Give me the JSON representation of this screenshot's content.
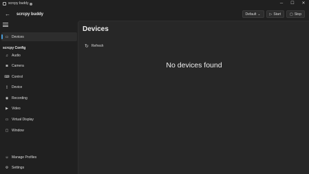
{
  "window": {
    "title": "scrcpy buddy",
    "controls": {
      "minimize": "─",
      "maximize": "☐",
      "close": "✕"
    }
  },
  "header": {
    "app_name": "scrcpy buddy",
    "back_icon": "←",
    "profile_label": "Default",
    "profile_icon": "⌄",
    "start_label": "Start",
    "start_icon": "▷",
    "stop_label": "Stop",
    "stop_icon": "▢"
  },
  "sidebar": {
    "items_top": [
      {
        "label": "Devices",
        "icon": "▭",
        "selected": true
      }
    ],
    "section_title": "scrcpy Config",
    "config_items": [
      {
        "label": "Audio",
        "icon": "♫"
      },
      {
        "label": "Camera",
        "icon": "◙"
      },
      {
        "label": "Control",
        "icon": "⌨"
      },
      {
        "label": "Device",
        "icon": "▯"
      },
      {
        "label": "Recording",
        "icon": "◉"
      },
      {
        "label": "Video",
        "icon": "▶"
      },
      {
        "label": "Virtual Display",
        "icon": "▭"
      },
      {
        "label": "Window",
        "icon": "▢"
      }
    ],
    "items_bottom": [
      {
        "label": "Manage Profiles",
        "icon": "☺"
      },
      {
        "label": "Settings",
        "icon": "⚙"
      }
    ]
  },
  "main": {
    "title": "Devices",
    "refresh_label": "Refresh",
    "refresh_icon": "↻",
    "empty_message": "No devices found"
  },
  "colors": {
    "accent": "#4a9eda",
    "background": "#202020",
    "content": "#272727"
  }
}
